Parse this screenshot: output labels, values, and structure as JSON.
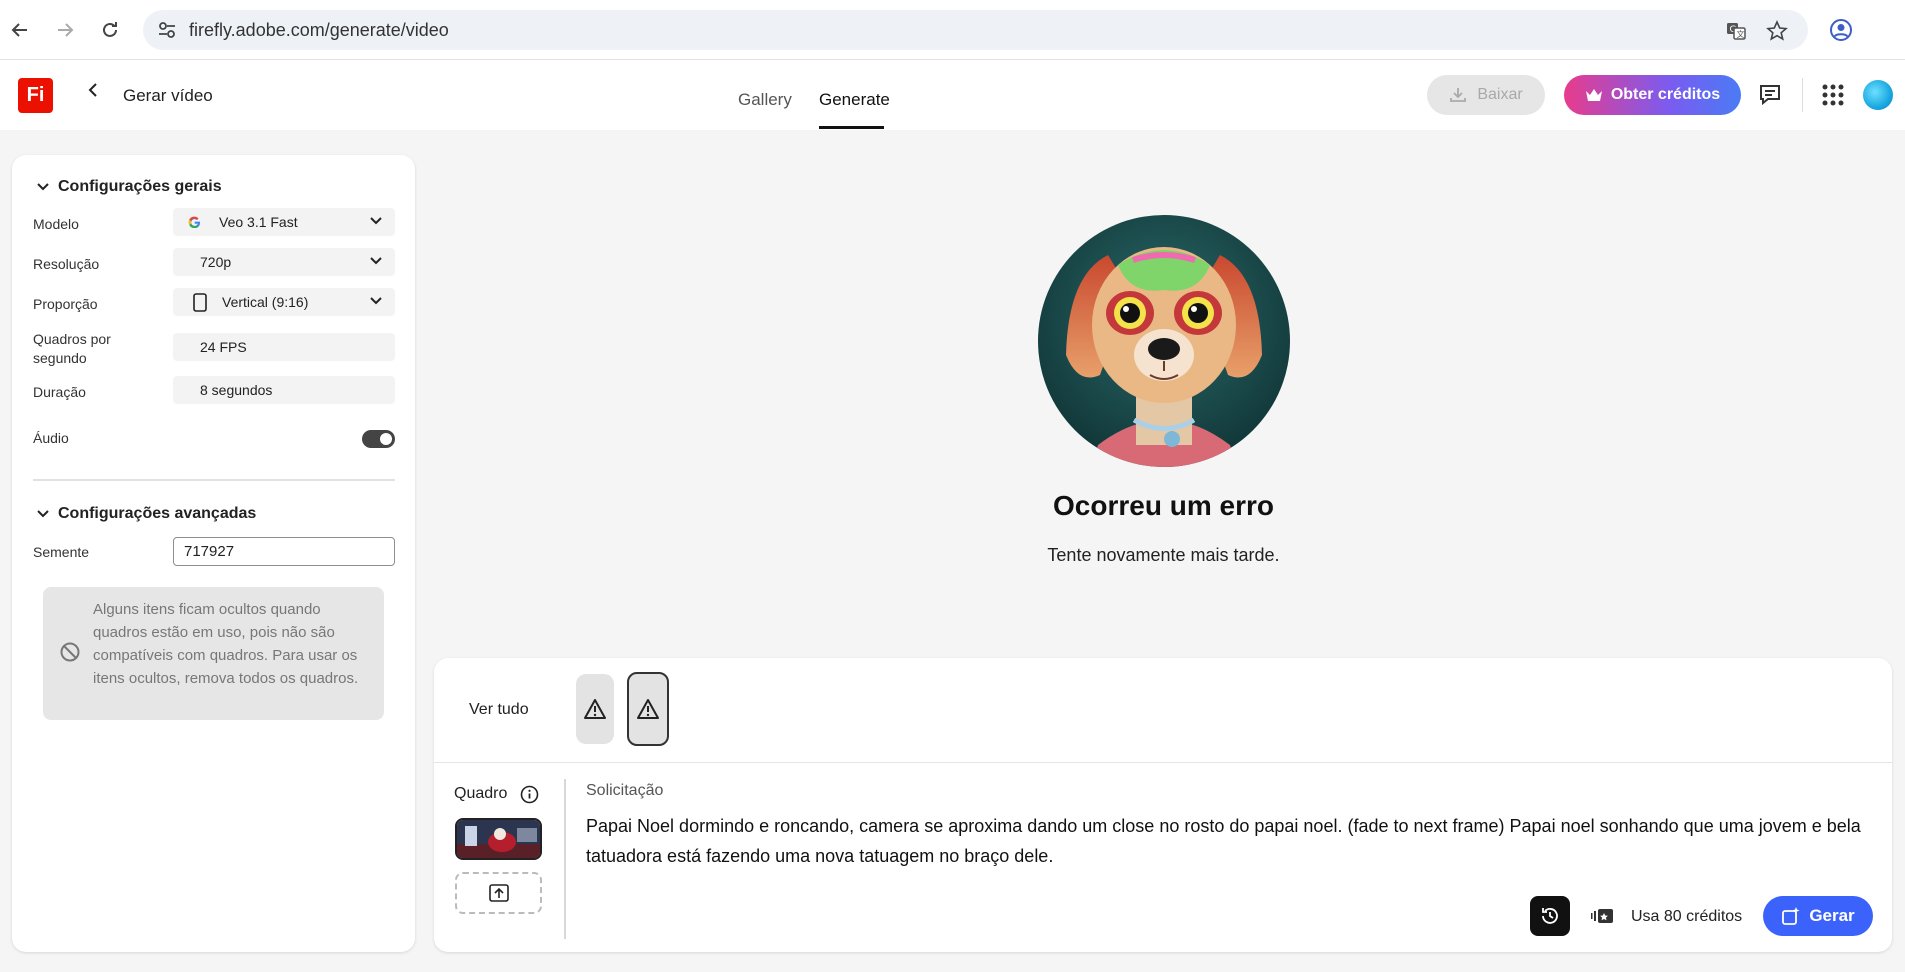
{
  "browser": {
    "url": "firefly.adobe.com/generate/video",
    "icons": [
      "back-arrow-icon",
      "forward-arrow-icon",
      "reload-icon",
      "site-settings-icon",
      "translate-icon",
      "bookmark-star-icon",
      "profile-icon"
    ]
  },
  "header": {
    "logo_text": "Fi",
    "back_label": "Gerar vídeo",
    "tabs": [
      {
        "label": "Gallery",
        "active": false
      },
      {
        "label": "Generate",
        "active": true
      }
    ],
    "download_label": "Baixar",
    "credits_label": "Obter créditos",
    "accent_gradient": [
      "#e83c8c",
      "#7a5cf0",
      "#4a7bf5"
    ]
  },
  "sidebar": {
    "general_title": "Configurações gerais",
    "settings": [
      {
        "label": "Modelo",
        "value": "Veo 3.1 Fast",
        "icon": "google-icon",
        "dropdown": true
      },
      {
        "label": "Resolução",
        "value": "720p",
        "dropdown": true
      },
      {
        "label": "Proporção",
        "value": "Vertical (9:16)",
        "icon": "portrait-ratio-icon",
        "dropdown": true
      },
      {
        "label": "Quadros por segundo",
        "value": "24 FPS"
      },
      {
        "label": "Duração",
        "value": "8 segundos"
      }
    ],
    "audio_label": "Áudio",
    "audio_on": true,
    "advanced_title": "Configurações avançadas",
    "seed_label": "Semente",
    "seed_value": "717927",
    "notice": "Alguns itens ficam ocultos quando quadros estão em uso, pois não são compatíveis com quadros. Para usar os itens ocultos, remova todos os quadros."
  },
  "main": {
    "error_title": "Ocorreu um erro",
    "error_subtitle": "Tente novamente mais tarde."
  },
  "composer": {
    "view_all_label": "Ver tudo",
    "frame_label": "Quadro",
    "prompt_label": "Solicitação",
    "prompt_text": "Papai Noel dormindo e roncando, camera se aproxima dando um close no rosto do papai noel. (fade to next frame) Papai noel sonhando que uma jovem e bela tatuadora está fazendo uma nova tatuagem no braço dele.",
    "credits_text": "Usa 80 créditos",
    "generate_label": "Gerar",
    "generate_color": "#3b63fb"
  }
}
